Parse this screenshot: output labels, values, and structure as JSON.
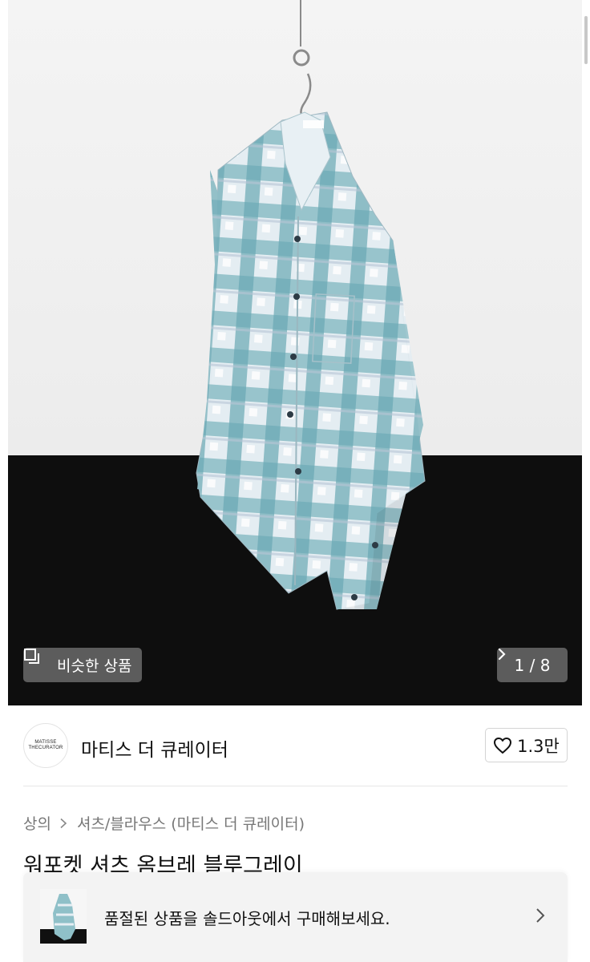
{
  "gallery": {
    "similar_label": "비슷한 상품",
    "similar_icon": "similar-items-icon",
    "counter": "1 / 8",
    "next_icon": "chevron-right-icon"
  },
  "shop": {
    "avatar_line1": "MATISSE",
    "avatar_line2": "THECURATOR",
    "name": "마티스 더 큐레이터",
    "like_count": "1.3만",
    "like_icon": "heart-outline-icon"
  },
  "breadcrumb": {
    "category": "상의",
    "subcategory": "셔츠/블라우스 (마티스 더 큐레이터)"
  },
  "product": {
    "title": "워포켓 셔츠 옴브레 블루그레이"
  },
  "banner": {
    "text": "품절된 상품을 솔드아웃에서 구매해보세요."
  },
  "colors": {
    "shirt_teal": "#7fb6bf",
    "shirt_light": "#e6eef3",
    "floor": "#0e0e0e",
    "wall": "#f2f2f2"
  }
}
